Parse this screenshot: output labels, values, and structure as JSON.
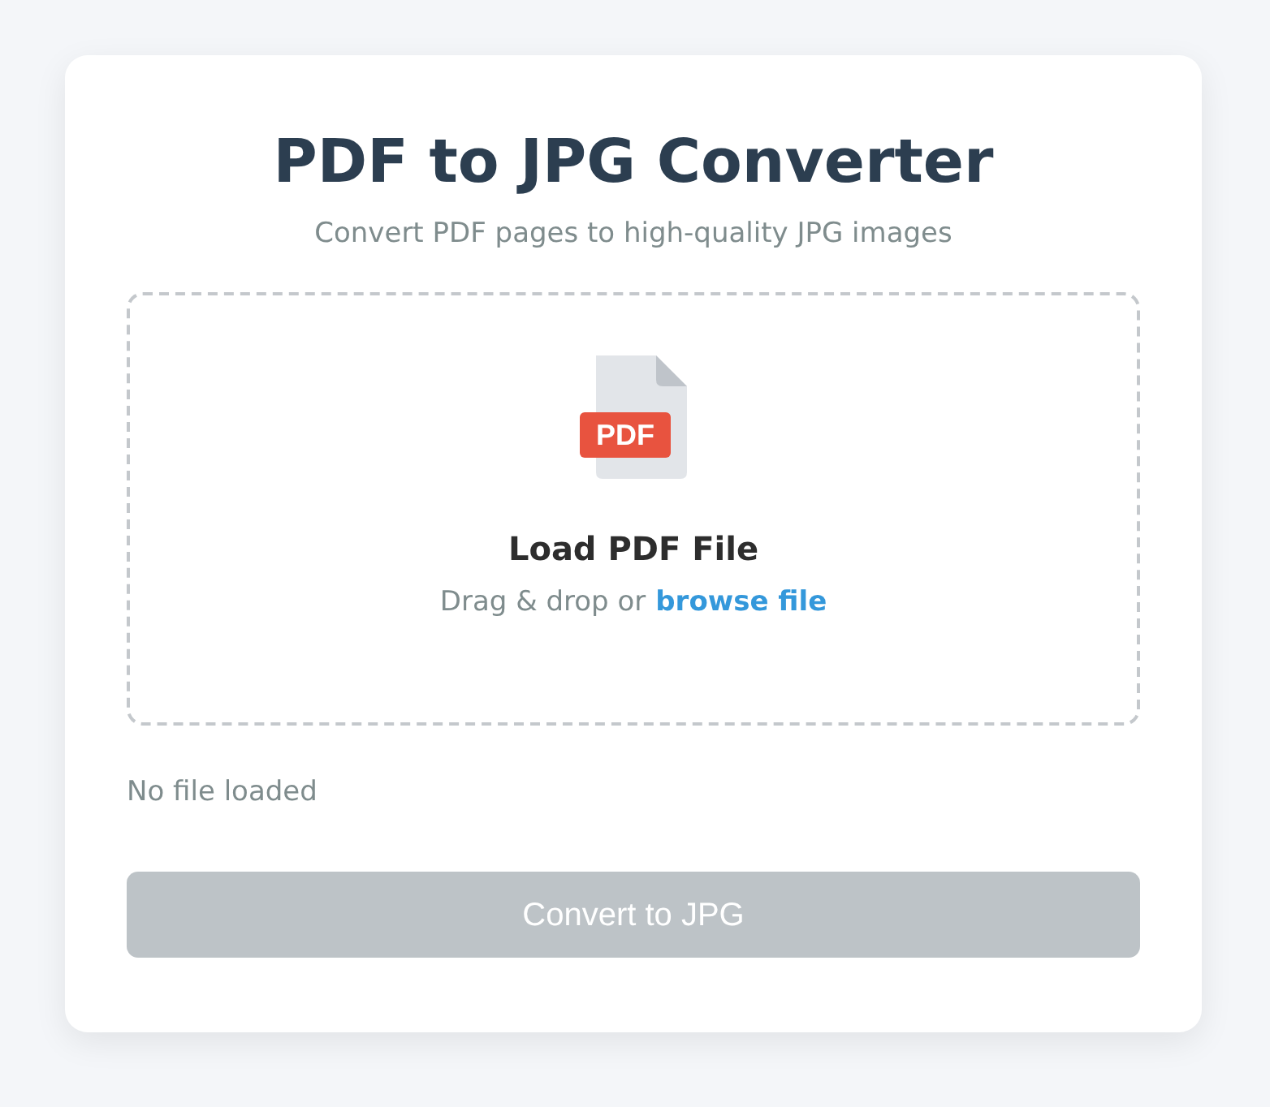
{
  "title": "PDF to JPG Converter",
  "subtitle": "Convert PDF pages to high-quality JPG images",
  "dropzone": {
    "icon_label": "PDF",
    "heading": "Load PDF File",
    "prompt": "Drag & drop or",
    "link": "browse file"
  },
  "status": "No file loaded",
  "convert_button": {
    "label": "Convert to JPG",
    "disabled": true
  }
}
